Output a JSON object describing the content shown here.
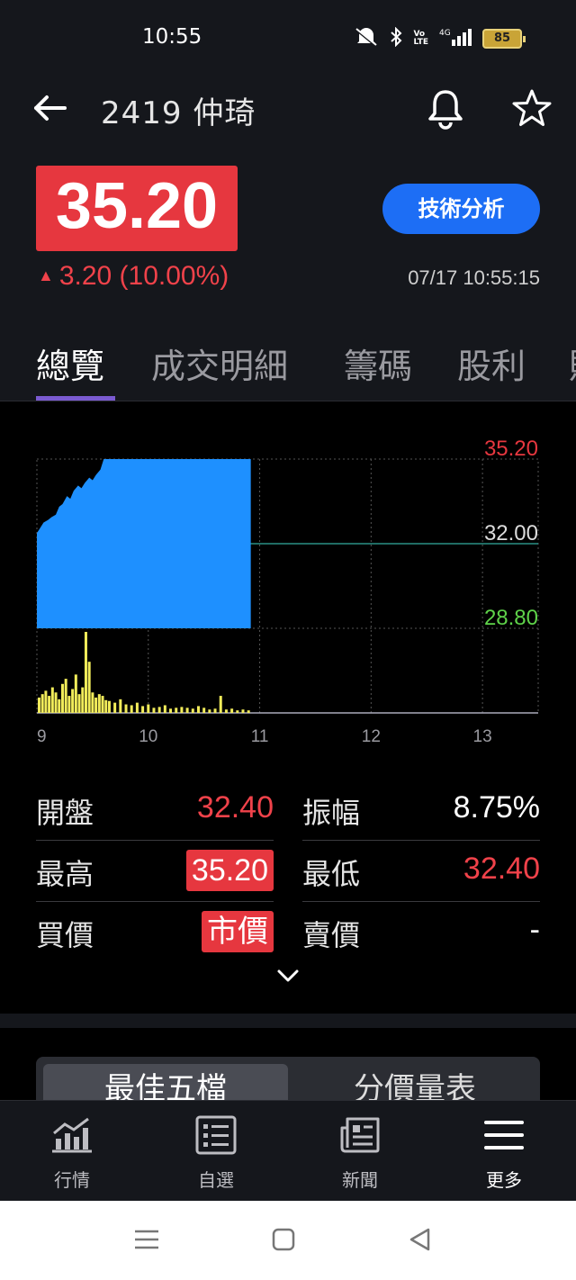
{
  "status_bar": {
    "time": "10:55",
    "battery": "85",
    "network": "4G"
  },
  "header": {
    "stock_title": "2419 仲琦",
    "price": "35.20",
    "change": "3.20 (10.00%)",
    "timestamp": "07/17 10:55:15",
    "tech_button": "技術分析"
  },
  "tabs": [
    {
      "label": "總覽",
      "active": true
    },
    {
      "label": "成交明細"
    },
    {
      "label": "籌碼"
    },
    {
      "label": "股利"
    },
    {
      "label": "財"
    }
  ],
  "chart_data": {
    "type": "area",
    "price_labels": {
      "high": "35.20",
      "reference": "32.00",
      "low": "28.80"
    },
    "ylim": [
      28.8,
      35.2
    ],
    "reference_price": 32.0,
    "x_ticks": [
      "9",
      "10",
      "11",
      "12",
      "13"
    ],
    "xlim_hours": [
      9,
      13.5
    ],
    "price_series": {
      "x": [
        9.0,
        9.03,
        9.06,
        9.1,
        9.13,
        9.17,
        9.2,
        9.23,
        9.27,
        9.3,
        9.33,
        9.37,
        9.4,
        9.43,
        9.47,
        9.5,
        9.53,
        9.57,
        9.6,
        9.65,
        10.0,
        10.5,
        10.92
      ],
      "y": [
        32.4,
        32.6,
        32.8,
        32.9,
        33.0,
        33.1,
        33.4,
        33.5,
        33.8,
        33.7,
        34.0,
        34.2,
        34.1,
        34.3,
        34.5,
        34.4,
        34.6,
        34.8,
        35.2,
        35.2,
        35.2,
        35.2,
        35.2
      ]
    },
    "volume_series": {
      "x": [
        9.02,
        9.05,
        9.08,
        9.11,
        9.14,
        9.17,
        9.2,
        9.23,
        9.26,
        9.29,
        9.32,
        9.35,
        9.38,
        9.41,
        9.44,
        9.47,
        9.5,
        9.53,
        9.56,
        9.59,
        9.62,
        9.65,
        9.7,
        9.75,
        9.8,
        9.85,
        9.9,
        9.95,
        10.0,
        10.05,
        10.1,
        10.15,
        10.2,
        10.25,
        10.3,
        10.35,
        10.4,
        10.45,
        10.5,
        10.55,
        10.6,
        10.65,
        10.7,
        10.75,
        10.8,
        10.85,
        10.9
      ],
      "v": [
        18,
        22,
        26,
        20,
        30,
        24,
        16,
        34,
        40,
        20,
        28,
        45,
        22,
        30,
        95,
        60,
        24,
        18,
        22,
        20,
        15,
        14,
        12,
        16,
        10,
        9,
        12,
        8,
        10,
        6,
        7,
        9,
        5,
        6,
        7,
        6,
        5,
        8,
        6,
        4,
        5,
        20,
        4,
        5,
        3,
        4,
        3
      ]
    }
  },
  "stats": {
    "rows": [
      {
        "l_label": "開盤",
        "l_value": "32.40",
        "r_label": "振幅",
        "r_value": "8.75%"
      },
      {
        "l_label": "最高",
        "l_value": "35.20",
        "r_label": "最低",
        "r_value": "32.40"
      },
      {
        "l_label": "買價",
        "l_value": "市價",
        "r_label": "賣價",
        "r_value": "-"
      }
    ]
  },
  "segment": {
    "active": "最佳五檔",
    "other": "分價量表"
  },
  "bottom_nav": [
    {
      "label": "行情",
      "icon": "chart-bar-icon"
    },
    {
      "label": "自選",
      "icon": "list-icon"
    },
    {
      "label": "新聞",
      "icon": "newspaper-icon"
    },
    {
      "label": "更多",
      "icon": "menu-icon",
      "active": true
    }
  ],
  "colors": {
    "up_red": "#e6373f",
    "accent_blue": "#1d6ef5",
    "chart_fill": "#1e90ff",
    "volume_yellow": "#f2ec5a",
    "low_green": "#5fd34a",
    "ref_line": "#2a8f86"
  }
}
